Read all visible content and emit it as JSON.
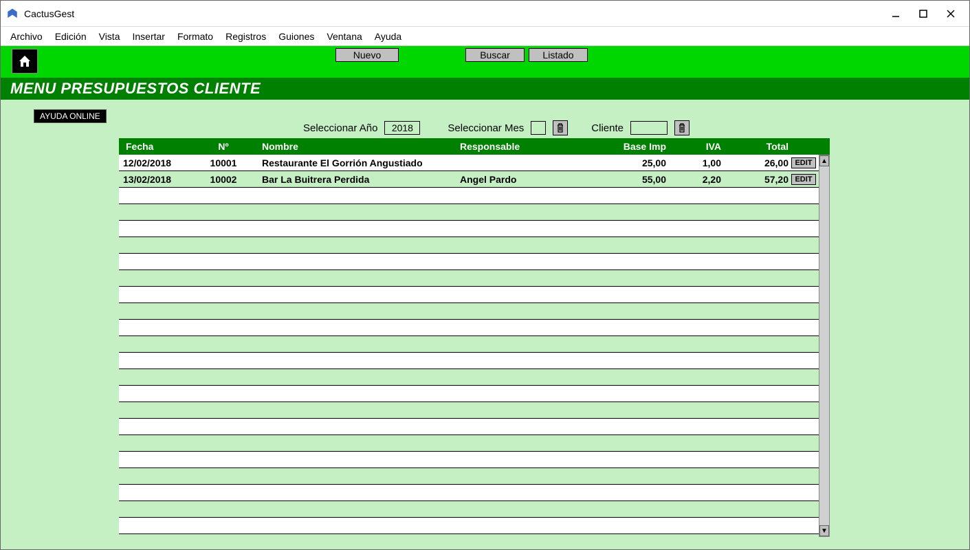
{
  "app": {
    "title": "CactusGest"
  },
  "menubar": {
    "items": [
      "Archivo",
      "Edición",
      "Vista",
      "Insertar",
      "Formato",
      "Registros",
      "Guiones",
      "Ventana",
      "Ayuda"
    ]
  },
  "toolbar": {
    "nuevo": "Nuevo",
    "buscar": "Buscar",
    "listado": "Listado"
  },
  "section_title": "MENU PRESUPUESTOS CLIENTE",
  "ayuda_online": "AYUDA ONLINE",
  "filters": {
    "year_label": "Seleccionar Año",
    "year_value": "2018",
    "month_label": "Seleccionar Mes",
    "month_value": "",
    "cliente_label": "Cliente",
    "cliente_value": ""
  },
  "table": {
    "headers": {
      "fecha": "Fecha",
      "num": "Nº",
      "nombre": "Nombre",
      "resp": "Responsable",
      "base": "Base Imp",
      "iva": "IVA",
      "total": "Total"
    },
    "rows": [
      {
        "fecha": "12/02/2018",
        "num": "10001",
        "nombre": "Restaurante El Gorrión Angustiado",
        "resp": "",
        "base": "25,00",
        "iva": "1,00",
        "total": "26,00",
        "edit": "EDIT"
      },
      {
        "fecha": "13/02/2018",
        "num": "10002",
        "nombre": "Bar La Buitrera Perdida",
        "resp": "Angel Pardo",
        "base": "55,00",
        "iva": "2,20",
        "total": "57,20",
        "edit": "EDIT"
      }
    ],
    "empty_rows": 22
  }
}
